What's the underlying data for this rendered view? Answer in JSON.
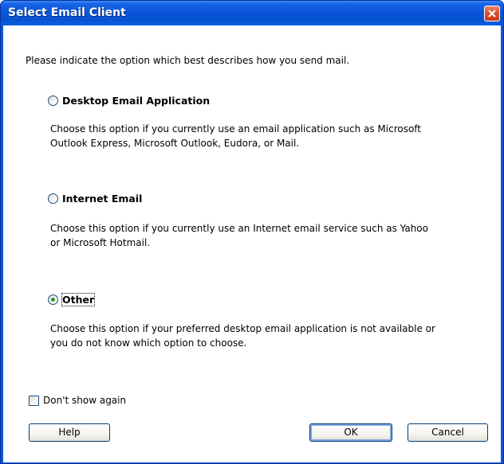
{
  "window": {
    "title": "Select Email Client"
  },
  "dialog": {
    "intro": "Please indicate the option which best describes how you send mail.",
    "options": [
      {
        "label": "Desktop Email Application",
        "description_lines": [
          "Choose this option if you currently use an email application such as Microsoft",
          "Outlook Express, Microsoft Outlook, Eudora, or Mail."
        ],
        "selected": false
      },
      {
        "label": "Internet Email",
        "description_lines": [
          "Choose this option if you currently use an Internet email service such as Yahoo",
          "or Microsoft Hotmail."
        ],
        "selected": false
      },
      {
        "label": "Other",
        "description_lines": [
          "Choose this option if your preferred desktop email application is not available or",
          "you do not know which option to choose."
        ],
        "selected": true
      }
    ],
    "dont_show_again": {
      "label": "Don't show again",
      "checked": false
    },
    "buttons": {
      "help": "Help",
      "ok": "OK",
      "cancel": "Cancel"
    }
  },
  "colors": {
    "title_bar": "#0a57d6",
    "close_button": "#d9512c",
    "radio_selected_dot": "#21a121"
  }
}
